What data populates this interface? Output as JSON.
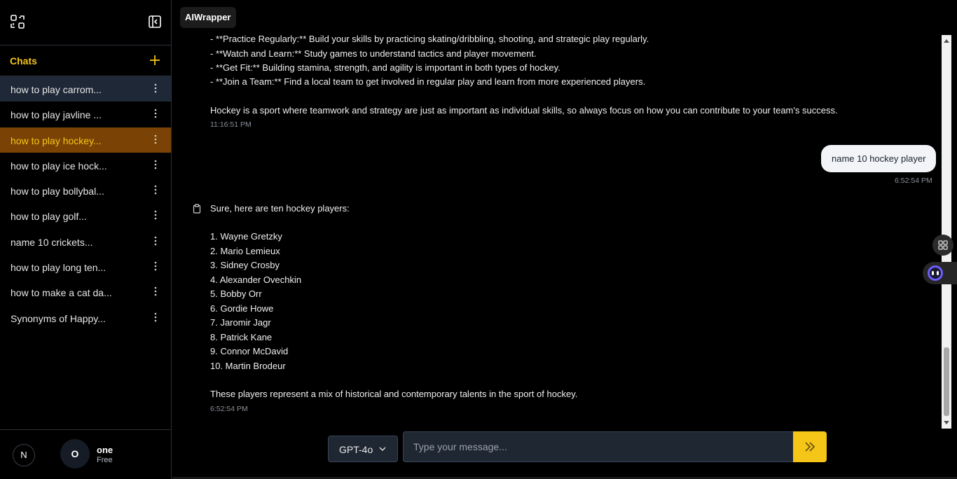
{
  "app": {
    "brand": "AIWrapper"
  },
  "sidebar": {
    "chats_title": "Chats",
    "items": [
      {
        "label": "how to play carrom...",
        "state": "hover"
      },
      {
        "label": "how to play javline ...",
        "state": ""
      },
      {
        "label": "how to play hockey...",
        "state": "active"
      },
      {
        "label": "how to play ice hock...",
        "state": ""
      },
      {
        "label": "how to play bollybal...",
        "state": ""
      },
      {
        "label": "how to play golf...",
        "state": ""
      },
      {
        "label": "name 10 crickets...",
        "state": ""
      },
      {
        "label": "how to play long ten...",
        "state": ""
      },
      {
        "label": "how to make a cat da...",
        "state": ""
      },
      {
        "label": "Synonyms of Happy...",
        "state": ""
      }
    ],
    "theme_button": "N",
    "user": {
      "initial": "O",
      "name": "one",
      "plan": "Free"
    }
  },
  "messages": {
    "prev_reply": {
      "lines": [
        "- **Practice Regularly:** Build your skills by practicing skating/dribbling, shooting, and strategic play regularly.",
        "- **Watch and Learn:** Study games to understand tactics and player movement.",
        "- **Get Fit:** Building stamina, strength, and agility is important in both types of hockey.",
        "- **Join a Team:** Find a local team to get involved in regular play and learn from more experienced players."
      ],
      "closing": "Hockey is a sport where teamwork and strategy are just as important as individual skills, so always focus on how you can contribute to your team's success.",
      "time": "11:16:51 PM"
    },
    "user_msg": {
      "text": "name 10 hockey player",
      "time": "6:52:54 PM"
    },
    "reply": {
      "intro": "Sure, here are ten hockey players:",
      "players": [
        "1. Wayne Gretzky",
        "2. Mario Lemieux",
        "3. Sidney Crosby",
        "4. Alexander Ovechkin",
        "5. Bobby Orr",
        "6. Gordie Howe",
        "7. Jaromir Jagr",
        "8. Patrick Kane",
        "9. Connor McDavid",
        "10. Martin Brodeur"
      ],
      "closing": "These players represent a mix of historical and contemporary talents in the sport of hockey.",
      "time": "6:52:54 PM"
    }
  },
  "input": {
    "model": "GPT-4o",
    "placeholder": "Type your message..."
  },
  "colors": {
    "accent": "#f5c518",
    "active_bg": "#7a4305",
    "hover_bg": "#1e2836",
    "input_bg": "#1f2733"
  },
  "icons": {
    "logo": "grid-arrows-icon",
    "collapse": "sidebar-collapse-icon",
    "new_chat": "plus-icon",
    "more": "vertical-dots-icon",
    "copy": "clipboard-icon",
    "chevron": "chevron-down-icon",
    "send": "double-chevron-right-icon",
    "grid": "grid-icon",
    "bot": "bot-icon"
  }
}
